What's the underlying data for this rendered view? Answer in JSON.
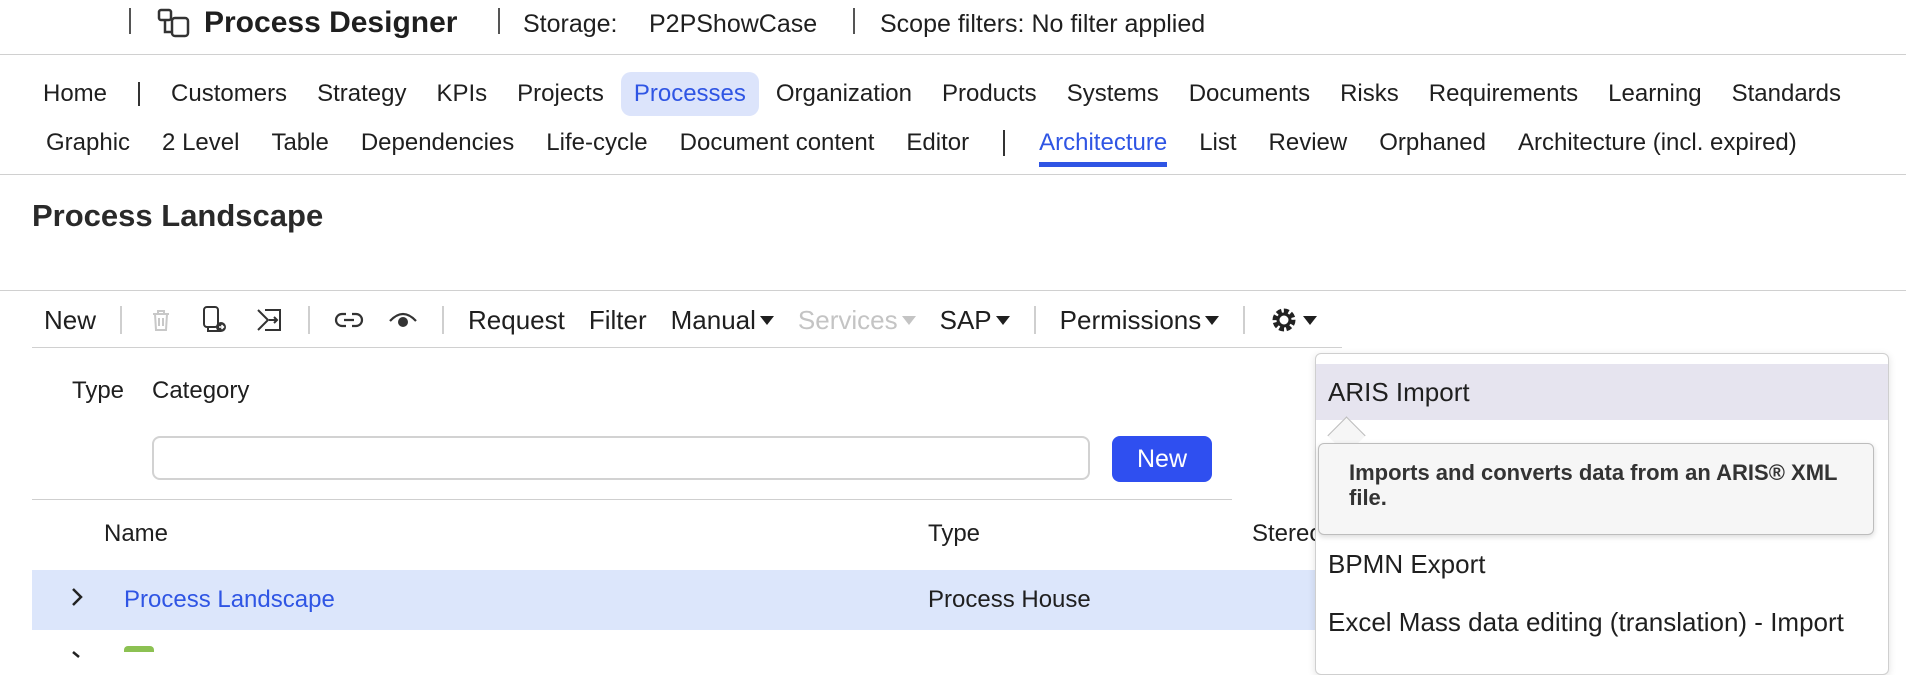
{
  "header": {
    "app_title": "Process Designer",
    "storage_label": "Storage:",
    "storage_value": "P2PShowCase",
    "scope_filters": "Scope filters: No filter applied"
  },
  "nav_primary": {
    "items": [
      "Home",
      "Customers",
      "Strategy",
      "KPIs",
      "Projects",
      "Processes",
      "Organization",
      "Products",
      "Systems",
      "Documents",
      "Risks",
      "Requirements",
      "Learning",
      "Standards"
    ],
    "active": "Processes"
  },
  "nav_secondary": {
    "items": [
      "Graphic",
      "2 Level",
      "Table",
      "Dependencies",
      "Life-cycle",
      "Document content",
      "Editor",
      "Architecture",
      "List",
      "Review",
      "Orphaned",
      "Architecture (incl. expired)"
    ],
    "active": "Architecture"
  },
  "page": {
    "title": "Process Landscape"
  },
  "toolbar": {
    "new_label": "New",
    "request_label": "Request",
    "filter_label": "Filter",
    "manual_label": "Manual",
    "services_label": "Services",
    "sap_label": "SAP",
    "permissions_label": "Permissions",
    "icons": [
      "trash-icon",
      "copy-document-icon",
      "move-icon",
      "link-icon",
      "eye-icon",
      "gear-icon"
    ]
  },
  "filter": {
    "type_label": "Type",
    "category_label": "Category",
    "input_value": "",
    "new_button": "New"
  },
  "table": {
    "columns": [
      "Name",
      "Type",
      "Stereo"
    ],
    "rows": [
      {
        "name": "Process Landscape",
        "type": "Process House"
      }
    ]
  },
  "settings_menu": {
    "items": [
      "ARIS Import",
      "BPMN Export",
      "Excel Mass data editing (translation) - Import"
    ],
    "hovered": "ARIS Import",
    "tooltip": "Imports and converts data from an ARIS® XML file."
  },
  "colors": {
    "accent": "#2f55e4",
    "active_tab_bg": "#dce4fb",
    "button_bg": "#2f4ff0",
    "selected_row_bg": "#dce6fb",
    "menu_hover_bg": "#e6e4ef"
  }
}
